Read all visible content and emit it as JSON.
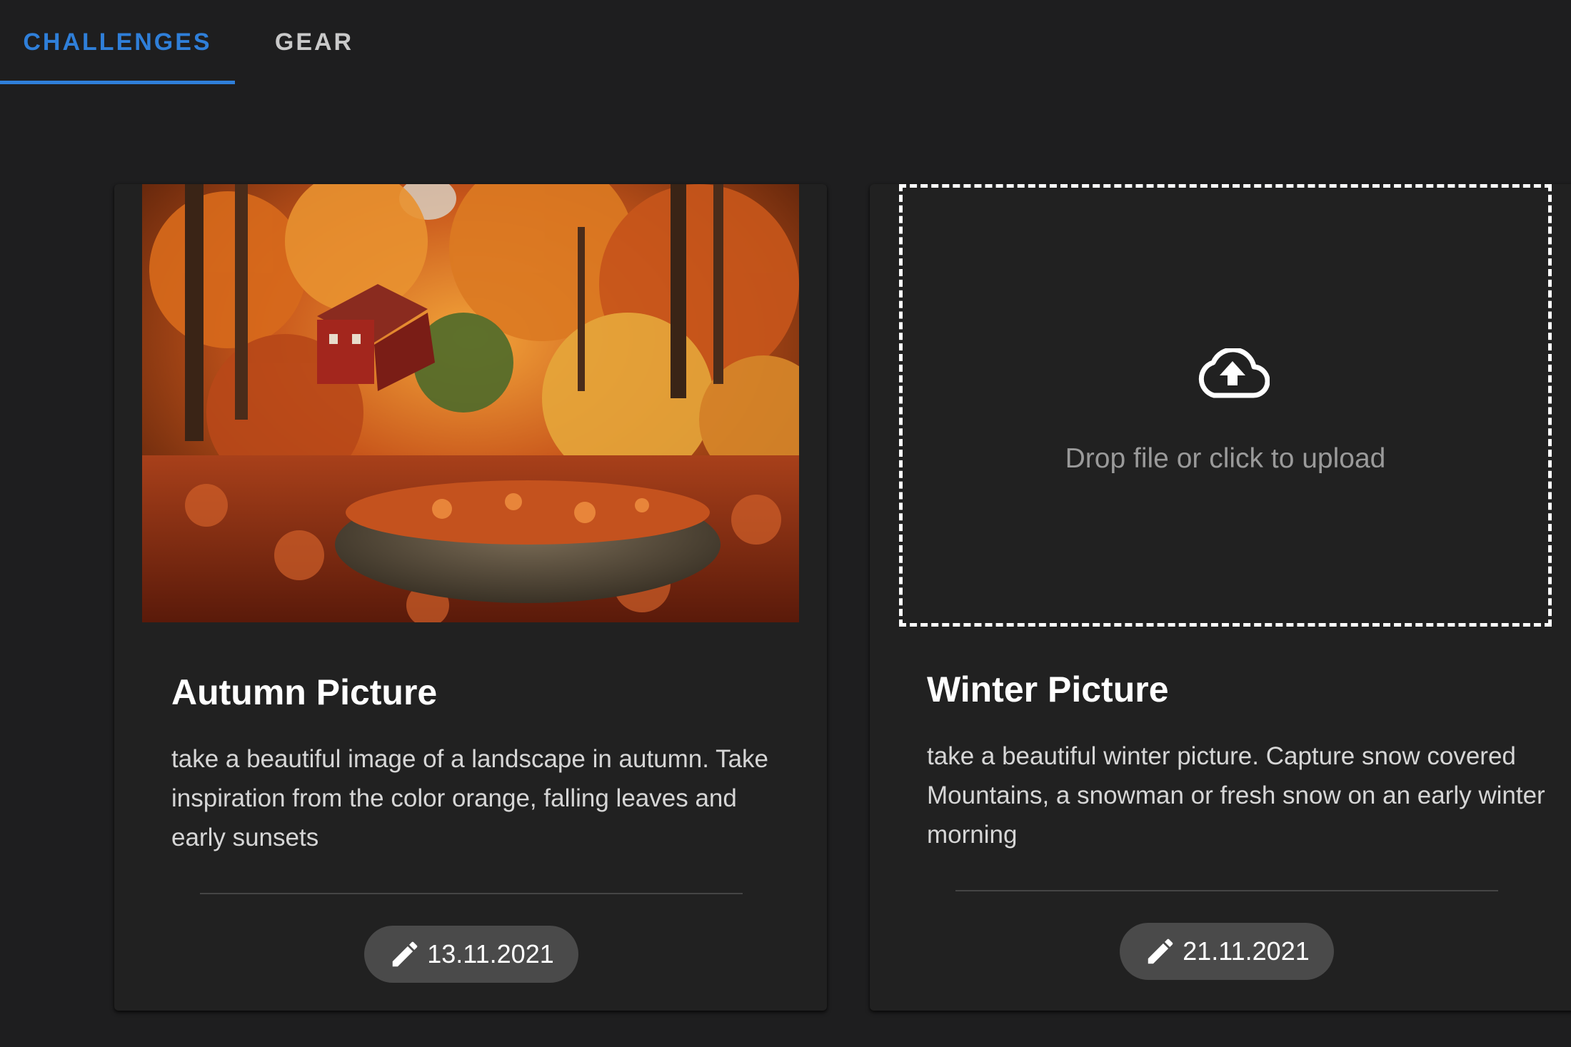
{
  "tabs": [
    {
      "label": "CHALLENGES",
      "active": true
    },
    {
      "label": "GEAR",
      "active": false
    }
  ],
  "colors": {
    "accent": "#2f7fd9",
    "background": "#1e1e1f",
    "card": "#212121",
    "chip": "#4a4a4a"
  },
  "cards": [
    {
      "media": "photo",
      "image_icon": "autumn-forest-photo",
      "title": "Autumn Picture",
      "description": "take a beautiful image of a landscape in autumn. Take inspiration from the color orange, falling leaves and early sunsets",
      "date_icon": "pencil-icon",
      "date": "13.11.2021"
    },
    {
      "media": "upload",
      "upload_icon": "cloud-upload-icon",
      "upload_text": "Drop file or click to upload",
      "title": "Winter Picture",
      "description": "take a beautiful winter picture. Capture snow covered Mountains, a snowman or fresh snow on an early winter morning",
      "date_icon": "pencil-icon",
      "date": "21.11.2021"
    }
  ]
}
